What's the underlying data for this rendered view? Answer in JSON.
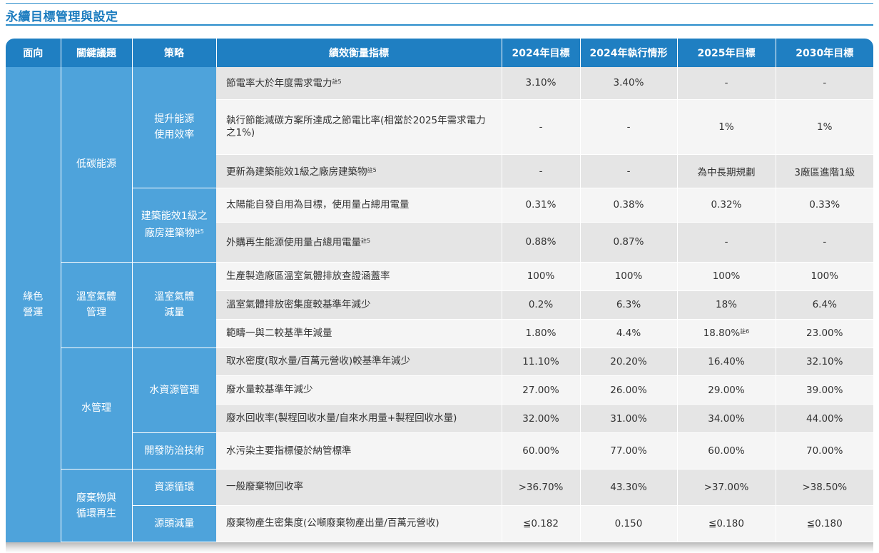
{
  "title": "永續目標管理與設定",
  "headers": {
    "area": "面向",
    "issue": "關鍵議題",
    "strategy": "策略",
    "metric": "績效衡量指標",
    "c2024t": "2024年目標",
    "c2024a": "2024年執行情形",
    "c2025t": "2025年目標",
    "c2030t": "2030年目標"
  },
  "area": [
    "綠色",
    "營運"
  ],
  "issues": {
    "low_carbon": "低碳能源",
    "ghg": [
      "溫室氣體",
      "管理"
    ],
    "water": "水管理",
    "waste": [
      "廢棄物與",
      "循環再生"
    ]
  },
  "strategies": {
    "energy_eff": [
      "提升能源",
      "使用效率"
    ],
    "green_bldg": [
      "建築能效1級之",
      "廠房建築物"
    ],
    "green_bldg_note": "註5",
    "ghg_reduce": [
      "溫室氣體",
      "減量"
    ],
    "water_res": "水資源管理",
    "pollution": "開發防治技術",
    "recycle": "資源循環",
    "source_reduce": "源頭減量"
  },
  "rows": [
    {
      "metric": "節電率大於年度需求電力",
      "note": "註5",
      "t2024": "3.10%",
      "a2024": "3.40%",
      "t2025": "-",
      "t2030": "-"
    },
    {
      "metric": "執行節能減碳方案所達成之節電比率(相當於2025年需求電力之1%)",
      "note": "",
      "t2024": "-",
      "a2024": "-",
      "t2025": "1%",
      "t2030": "1%"
    },
    {
      "metric": "更新為建築能效1級之廠房建築物",
      "note": "註5",
      "t2024": "-",
      "a2024": "-",
      "t2025": "為中長期規劃",
      "t2030": "3廠區進階1級"
    },
    {
      "metric": "太陽能自發自用為目標，使用量占總用電量",
      "note": "",
      "t2024": "0.31%",
      "a2024": "0.38%",
      "t2025": "0.32%",
      "t2030": "0.33%"
    },
    {
      "metric": "外購再生能源使用量占總用電量",
      "note": "註5",
      "t2024": "0.88%",
      "a2024": "0.87%",
      "t2025": "-",
      "t2030": "-"
    },
    {
      "metric": "生產製造廠區溫室氣體排放查證涵蓋率",
      "note": "",
      "t2024": "100%",
      "a2024": "100%",
      "t2025": "100%",
      "t2030": "100%"
    },
    {
      "metric": "溫室氣體排放密集度較基準年減少",
      "note": "",
      "t2024": "0.2%",
      "a2024": "6.3%",
      "t2025": "18%",
      "t2030": "6.4%"
    },
    {
      "metric": "範疇一與二較基準年減量",
      "note": "",
      "t2024": "1.80%",
      "a2024": "4.4%",
      "t2025": "18.80%",
      "t2025_note": "註6",
      "t2030": "23.00%"
    },
    {
      "metric": "取水密度(取水量/百萬元營收)較基準年減少",
      "note": "",
      "t2024": "11.10%",
      "a2024": "20.20%",
      "t2025": "16.40%",
      "t2030": "32.10%"
    },
    {
      "metric": "廢水量較基準年減少",
      "note": "",
      "t2024": "27.00%",
      "a2024": "26.00%",
      "t2025": "29.00%",
      "t2030": "39.00%"
    },
    {
      "metric": "廢水回收率(製程回收水量/自來水用量+製程回收水量)",
      "note": "",
      "t2024": "32.00%",
      "a2024": "31.00%",
      "t2025": "34.00%",
      "t2030": "44.00%"
    },
    {
      "metric": "水污染主要指標優於納管標準",
      "note": "",
      "t2024": "60.00%",
      "a2024": "77.00%",
      "t2025": "60.00%",
      "t2030": "70.00%"
    },
    {
      "metric": "一般廢棄物回收率",
      "note": "",
      "t2024": ">36.70%",
      "a2024": "43.30%",
      "t2025": ">37.00%",
      "t2030": ">38.50%"
    },
    {
      "metric": "廢棄物產生密集度(公噸廢棄物產出量/百萬元營收)",
      "note": "",
      "t2024": "≦0.182",
      "a2024": "0.150",
      "t2025": "≦0.180",
      "t2030": "≦0.180"
    }
  ]
}
